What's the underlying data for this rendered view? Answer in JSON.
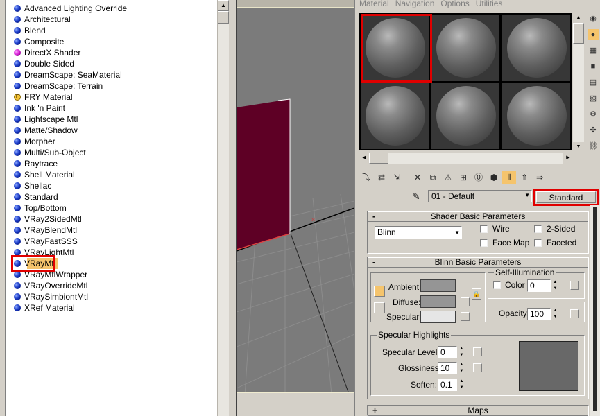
{
  "material_browser": {
    "items": [
      {
        "label": "Advanced Lighting Override",
        "icon": "blue-sphere-icon"
      },
      {
        "label": "Architectural",
        "icon": "blue-sphere-icon"
      },
      {
        "label": "Blend",
        "icon": "blue-sphere-icon"
      },
      {
        "label": "Composite",
        "icon": "blue-sphere-icon"
      },
      {
        "label": "DirectX Shader",
        "icon": "magenta-sphere-icon"
      },
      {
        "label": "Double Sided",
        "icon": "blue-sphere-icon"
      },
      {
        "label": "DreamScape: SeaMaterial",
        "icon": "blue-sphere-icon"
      },
      {
        "label": "DreamScape: Terrain",
        "icon": "blue-sphere-icon"
      },
      {
        "label": "FRY Material",
        "icon": "fry-icon"
      },
      {
        "label": "Ink 'n Paint",
        "icon": "blue-sphere-icon"
      },
      {
        "label": "Lightscape Mtl",
        "icon": "blue-sphere-icon"
      },
      {
        "label": "Matte/Shadow",
        "icon": "blue-sphere-icon"
      },
      {
        "label": "Morpher",
        "icon": "blue-sphere-icon"
      },
      {
        "label": "Multi/Sub-Object",
        "icon": "blue-sphere-icon"
      },
      {
        "label": "Raytrace",
        "icon": "blue-sphere-icon"
      },
      {
        "label": "Shell Material",
        "icon": "blue-sphere-icon"
      },
      {
        "label": "Shellac",
        "icon": "blue-sphere-icon"
      },
      {
        "label": "Standard",
        "icon": "blue-sphere-icon"
      },
      {
        "label": "Top/Bottom",
        "icon": "blue-sphere-icon"
      },
      {
        "label": "VRay2SidedMtl",
        "icon": "blue-sphere-icon"
      },
      {
        "label": "VRayBlendMtl",
        "icon": "blue-sphere-icon"
      },
      {
        "label": "VRayFastSSS",
        "icon": "blue-sphere-icon"
      },
      {
        "label": "VRayLightMtl",
        "icon": "blue-sphere-icon"
      },
      {
        "label": "VRayMtl",
        "icon": "blue-sphere-icon",
        "selected": true
      },
      {
        "label": "VRayMtlWrapper",
        "icon": "blue-sphere-icon"
      },
      {
        "label": "VRayOverrideMtl",
        "icon": "blue-sphere-icon"
      },
      {
        "label": "VRaySimbiontMtl",
        "icon": "blue-sphere-icon"
      },
      {
        "label": "XRef Material",
        "icon": "blue-sphere-icon"
      }
    ]
  },
  "material_editor": {
    "menu": [
      "Material",
      "Navigation",
      "Options",
      "Utilities"
    ],
    "material_name": "01 - Default",
    "material_type_button": "Standard",
    "shader_basic": {
      "title": "Shader Basic Parameters",
      "shader": "Blinn",
      "wire": "Wire",
      "two_sided": "2-Sided",
      "face_map": "Face Map",
      "faceted": "Faceted"
    },
    "blinn_basic": {
      "title": "Blinn Basic Parameters",
      "ambient": "Ambient:",
      "diffuse": "Diffuse:",
      "specular": "Specular:",
      "self_illumination": "Self-Illumination",
      "color": "Color",
      "color_value": "0",
      "opacity": "Opacity:",
      "opacity_value": "100",
      "specular_highlights": "Specular Highlights",
      "specular_level": "Specular Level:",
      "specular_level_value": "0",
      "glossiness": "Glossiness:",
      "glossiness_value": "10",
      "soften": "Soften:",
      "soften_value": "0.1"
    },
    "maps": "Maps",
    "sign_minus": "-",
    "sign_plus": "+"
  },
  "colors": {
    "highlight_red": "#e00000",
    "wall_maroon": "#5e0025",
    "viewport_gray": "#7b7b7b",
    "selection_fill": "#f5c46c"
  }
}
